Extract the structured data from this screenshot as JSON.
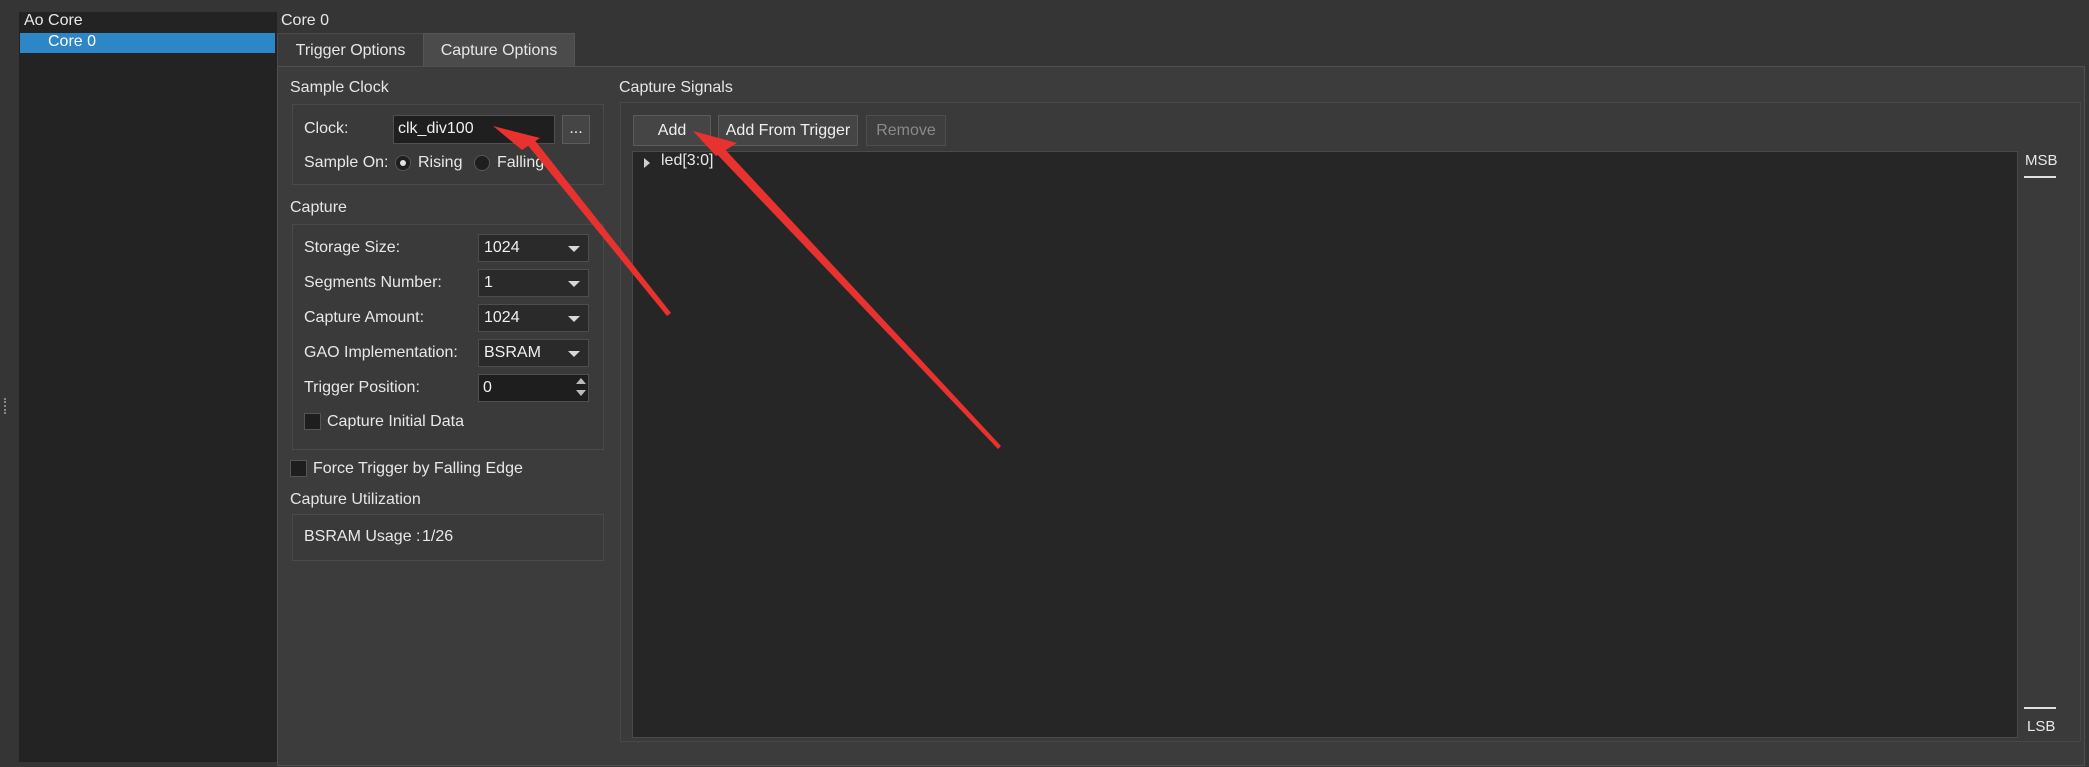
{
  "tree": {
    "root": "Ao Core",
    "items": [
      {
        "label": "Core 0",
        "selected": true
      }
    ]
  },
  "header": {
    "title": "Core 0"
  },
  "tabs": [
    {
      "label": "Trigger Options",
      "active": false
    },
    {
      "label": "Capture Options",
      "active": true
    }
  ],
  "sample_clock": {
    "title": "Sample Clock",
    "clock_label": "Clock:",
    "clock_value": "clk_div100",
    "browse_label": "...",
    "sample_on_label": "Sample On:",
    "rising_label": "Rising",
    "falling_label": "Falling",
    "selected_edge": "Rising"
  },
  "capture": {
    "title": "Capture",
    "storage_size_label": "Storage Size:",
    "storage_size_value": "1024",
    "segments_label": "Segments Number:",
    "segments_value": "1",
    "capture_amount_label": "Capture Amount:",
    "capture_amount_value": "1024",
    "gao_label": "GAO Implementation:",
    "gao_value": "BSRAM",
    "trigger_position_label": "Trigger Position:",
    "trigger_position_value": "0",
    "capture_initial_label": "Capture Initial Data",
    "capture_initial_checked": false
  },
  "force_trigger": {
    "label": "Force Trigger by Falling Edge",
    "checked": false
  },
  "utilization": {
    "title": "Capture Utilization",
    "bsram_label": "BSRAM Usage :",
    "bsram_value": "1/26"
  },
  "signals": {
    "title": "Capture Signals",
    "add_label": "Add",
    "add_from_trigger_label": "Add From Trigger",
    "remove_label": "Remove",
    "items": [
      {
        "label": "led[3:0]"
      }
    ],
    "msb_label": "MSB",
    "lsb_label": "LSB"
  },
  "colors": {
    "background": "#353535",
    "selection": "#2d86c6",
    "annotation_arrow": "#e8322f"
  }
}
